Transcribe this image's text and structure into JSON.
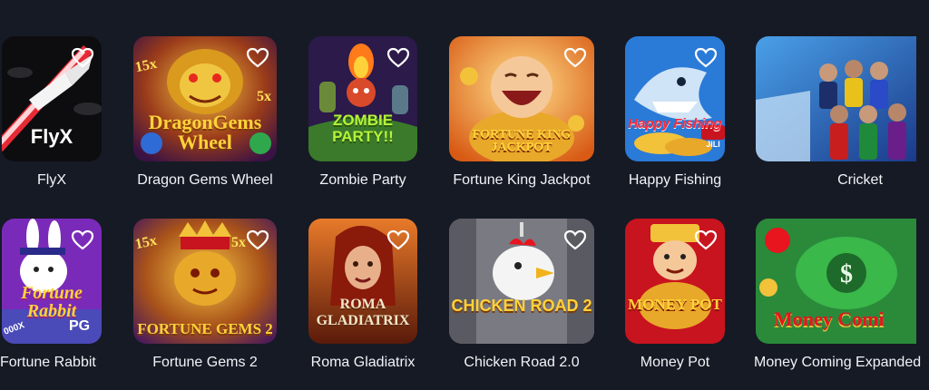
{
  "games": [
    {
      "title": "FlyX",
      "logo": "FlyX"
    },
    {
      "title": "Dragon Gems Wheel",
      "logo": "DragonGems Wheel",
      "badge_left": "15x",
      "badge_right": "5x"
    },
    {
      "title": "Zombie Party",
      "logo": "ZOMBIE PARTY!!"
    },
    {
      "title": "Fortune King Jackpot",
      "logo": "FORTUNE KING JACKPOT"
    },
    {
      "title": "Happy Fishing",
      "logo": "Happy Fishing",
      "badge": "JILI"
    },
    {
      "title": "Cricket"
    },
    {
      "title": "Fortune Rabbit",
      "logo": "Fortune Rabbit",
      "badge": "PG",
      "corner": "000X"
    },
    {
      "title": "Fortune Gems 2",
      "logo": "FORTUNE GEMS 2",
      "badge_left": "15x",
      "badge_right": "5x"
    },
    {
      "title": "Roma Gladiatrix",
      "logo": "ROMA GLADIATRIX"
    },
    {
      "title": "Chicken Road 2.0",
      "logo": "CHICKEN ROAD 2"
    },
    {
      "title": "Money Pot",
      "logo": "MONEY POT"
    },
    {
      "title": "Money Coming Expanded",
      "logo": "Money Comi"
    }
  ],
  "colors": {
    "background": "#161a25",
    "title_text": "#f2f3f7",
    "heart_stroke": "#ffffff"
  },
  "icons": {
    "favorite": "heart-outline-icon"
  }
}
